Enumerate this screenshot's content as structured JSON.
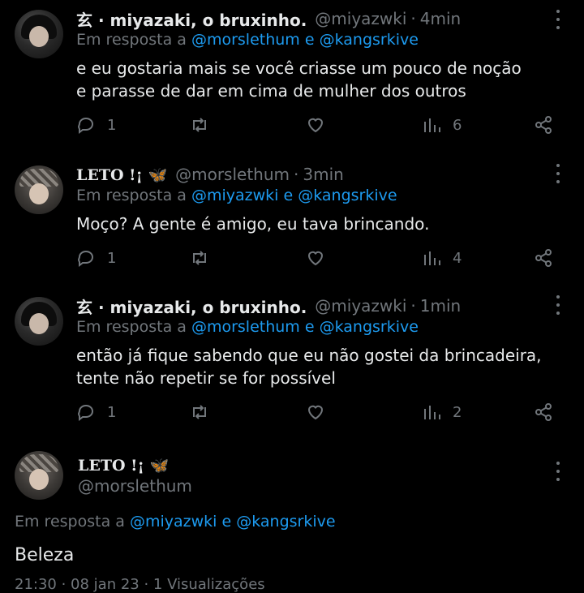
{
  "tweets": [
    {
      "name": "玄 · miyazaki, o bruxinho.",
      "handle": "@miyazwki",
      "sep": "·",
      "time": "4min",
      "reply_prefix": "Em resposta a",
      "mention1": "@morslethum",
      "conj": "e",
      "mention2": "@kangsrkive",
      "text": "e eu gostaria mais se você criasse um pouco de noção e parasse de dar em cima de mulher dos outros",
      "replies": "1",
      "views": "6"
    },
    {
      "name": "LETO !¡ 🦋",
      "handle": "@morslethum",
      "sep": "·",
      "time": "3min",
      "reply_prefix": "Em resposta a",
      "mention1": "@miyazwki",
      "conj": "e",
      "mention2": "@kangsrkive",
      "text": "Moço? A gente é amigo, eu tava brincando.",
      "replies": "1",
      "views": "4"
    },
    {
      "name": "玄 · miyazaki, o bruxinho.",
      "handle": "@miyazwki",
      "sep": "·",
      "time": "1min",
      "reply_prefix": "Em resposta a",
      "mention1": "@morslethum",
      "conj": "e",
      "mention2": "@kangsrkive",
      "text": "então já fique sabendo que eu não gostei da brincadeira, tente não repetir se for possível",
      "replies": "1",
      "views": "2"
    }
  ],
  "focused": {
    "name": "LETO !¡ 🦋",
    "handle": "@morslethum",
    "reply_prefix": "Em resposta a",
    "mention1": "@miyazwki",
    "conj": "e",
    "mention2": "@kangsrkive",
    "text": "Beleza",
    "cut_meta": "21:30 · 08 jan 23 · 1 Visualizações"
  },
  "icons": {
    "reply": "reply-icon",
    "retweet": "retweet-icon",
    "like": "heart-icon",
    "views": "views-icon",
    "share": "share-icon",
    "more": "more-icon"
  },
  "colors": {
    "background": "#000000",
    "text": "#e7e9ea",
    "secondary": "#71767b",
    "link": "#1d9bf0"
  }
}
